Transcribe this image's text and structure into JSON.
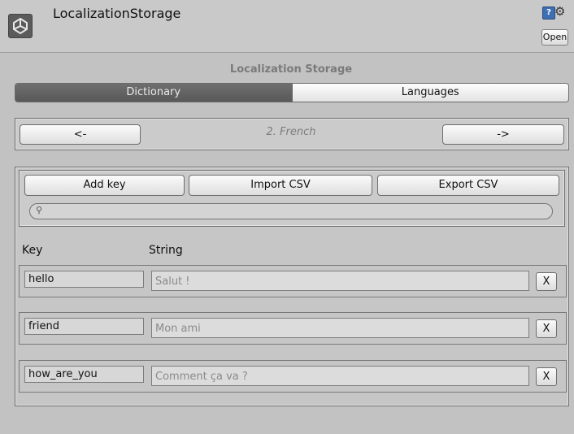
{
  "header": {
    "title": "LocalizationStorage",
    "open_label": "Open",
    "help_glyph": "?",
    "gear_glyph": "⚙"
  },
  "panel": {
    "title": "Localization Storage",
    "tabs": [
      {
        "label": "Dictionary",
        "active": true
      },
      {
        "label": "Languages",
        "active": false
      }
    ]
  },
  "language_nav": {
    "prev_label": "<-",
    "current": "2. French",
    "next_label": "->"
  },
  "toolbar": {
    "add_key": "Add key",
    "import_csv": "Import CSV",
    "export_csv": "Export CSV"
  },
  "search": {
    "placeholder": "",
    "icon": "search-icon"
  },
  "columns": {
    "key": "Key",
    "string": "String"
  },
  "entries": [
    {
      "key": "hello",
      "string": "Salut !",
      "remove": "X"
    },
    {
      "key": "friend",
      "string": "Mon ami",
      "remove": "X"
    },
    {
      "key": "how_are_you",
      "string": "Comment ça va ?",
      "remove": "X"
    }
  ],
  "colors": {
    "background": "#c2c2c2",
    "active_tab": "#5f5f5f",
    "help_icon": "#3d6fb5"
  }
}
